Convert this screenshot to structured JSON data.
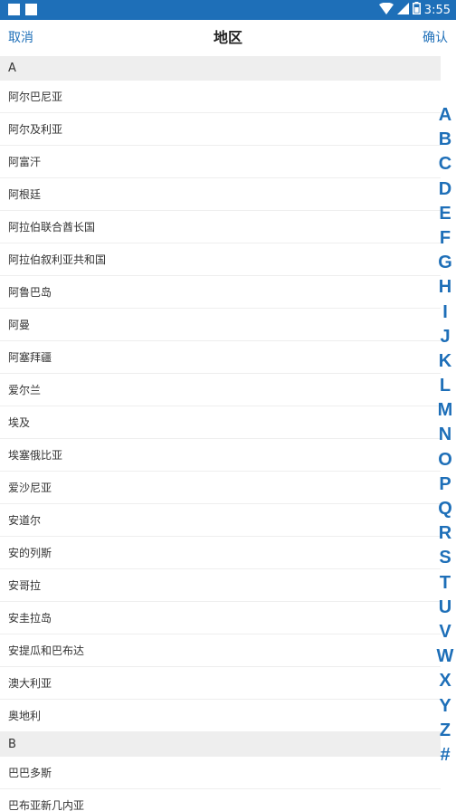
{
  "status_bar": {
    "time": "3:55",
    "background_color": "#1e6fb8",
    "icons": [
      "notification-square-icon",
      "notification-square-icon",
      "wifi-icon",
      "signal-icon",
      "battery-icon"
    ]
  },
  "header": {
    "cancel_label": "取消",
    "title": "地区",
    "confirm_label": "确认",
    "accent_color": "#1e6fb8"
  },
  "sections": [
    {
      "letter": "A",
      "items": [
        "阿尔巴尼亚",
        "阿尔及利亚",
        "阿富汗",
        "阿根廷",
        "阿拉伯联合酋长国",
        "阿拉伯叙利亚共和国",
        "阿鲁巴岛",
        "阿曼",
        "阿塞拜疆",
        "爱尔兰",
        "埃及",
        "埃塞俄比亚",
        "爱沙尼亚",
        "安道尔",
        "安的列斯",
        "安哥拉",
        "安圭拉岛",
        "安提瓜和巴布达",
        "澳大利亚",
        "奥地利"
      ]
    },
    {
      "letter": "B",
      "items": [
        "巴巴多斯",
        "巴布亚新几内亚"
      ]
    }
  ],
  "index_letters": [
    "A",
    "B",
    "C",
    "D",
    "E",
    "F",
    "G",
    "H",
    "I",
    "J",
    "K",
    "L",
    "M",
    "N",
    "O",
    "P",
    "Q",
    "R",
    "S",
    "T",
    "U",
    "V",
    "W",
    "X",
    "Y",
    "Z",
    "#"
  ]
}
